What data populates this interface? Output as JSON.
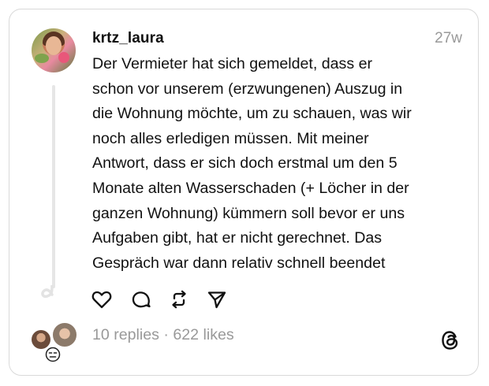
{
  "post": {
    "username": "krtz_laura",
    "time": "27w",
    "lines": [
      "Der Vermieter hat sich gemeldet, dass er",
      "schon vor unserem (erzwungenen) Auszug in",
      "die Wohnung möchte, um zu schauen, was wir",
      "noch alles erledigen müssen. Mit meiner",
      "Antwort, dass er sich doch erstmal um den 5",
      "Monate alten Wasserschaden (+ Löcher in der",
      "ganzen Wohnung) kümmern soll bevor er uns",
      "Aufgaben gibt, hat er nicht gerechnet. Das",
      "Gespräch war dann relativ schnell beendet"
    ]
  },
  "actions": {
    "like_icon": "heart-icon",
    "reply_icon": "comment-icon",
    "repost_icon": "repost-icon",
    "share_icon": "send-icon"
  },
  "footer": {
    "stats": "10 replies · 622 likes",
    "logo_icon": "threads-logo-icon",
    "emoji": "expressionless-face-emoji"
  }
}
